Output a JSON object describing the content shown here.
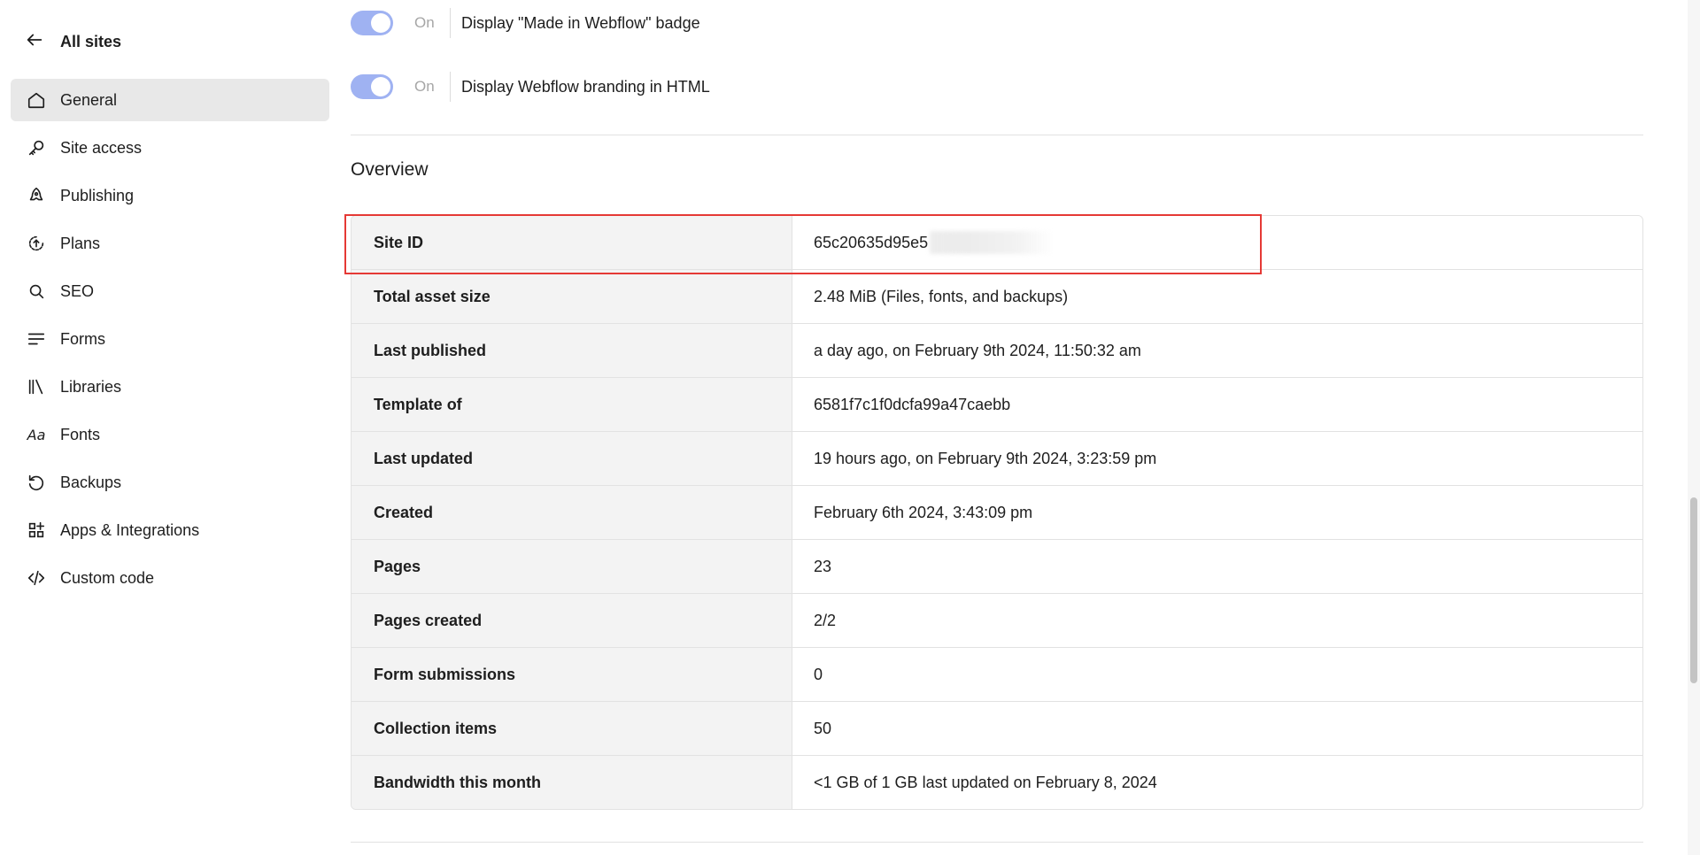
{
  "sidebar": {
    "back_label": "All sites",
    "items": [
      {
        "label": "General",
        "icon": "home-icon",
        "active": true
      },
      {
        "label": "Site access",
        "icon": "key-icon"
      },
      {
        "label": "Publishing",
        "icon": "rocket-icon"
      },
      {
        "label": "Plans",
        "icon": "plans-icon"
      },
      {
        "label": "SEO",
        "icon": "search-icon"
      },
      {
        "label": "Forms",
        "icon": "forms-icon"
      },
      {
        "label": "Libraries",
        "icon": "libraries-icon"
      },
      {
        "label": "Fonts",
        "icon": "fonts-icon",
        "glyph": "Aa"
      },
      {
        "label": "Backups",
        "icon": "backups-icon"
      },
      {
        "label": "Apps & Integrations",
        "icon": "apps-icon"
      },
      {
        "label": "Custom code",
        "icon": "code-icon"
      }
    ]
  },
  "toggles": [
    {
      "state": "On",
      "label": "Display \"Made in Webflow\" badge",
      "on": true
    },
    {
      "state": "On",
      "label": "Display Webflow branding in HTML",
      "on": true
    }
  ],
  "overview": {
    "title": "Overview",
    "rows": [
      {
        "key": "Site ID",
        "value": "65c20635d95e5"
      },
      {
        "key": "Total asset size",
        "value": "2.48 MiB (Files, fonts, and backups)"
      },
      {
        "key": "Last published",
        "value": "a day ago, on February 9th 2024, 11:50:32 am"
      },
      {
        "key": "Template of",
        "value": "6581f7c1f0dcfa99a47caebb"
      },
      {
        "key": "Last updated",
        "value": "19 hours ago, on February 9th 2024, 3:23:59 pm"
      },
      {
        "key": "Created",
        "value": "February 6th 2024, 3:43:09 pm"
      },
      {
        "key": "Pages",
        "value": "23"
      },
      {
        "key": "Pages created",
        "value": "2/2"
      },
      {
        "key": "Form submissions",
        "value": "0"
      },
      {
        "key": "Collection items",
        "value": "50"
      },
      {
        "key": "Bandwidth this month",
        "value": "<1 GB of 1 GB last updated on February 8, 2024"
      }
    ]
  },
  "colors": {
    "toggle_on": "#9fb2f2",
    "highlight": "#e53935",
    "active_nav": "#e8e8e8"
  }
}
